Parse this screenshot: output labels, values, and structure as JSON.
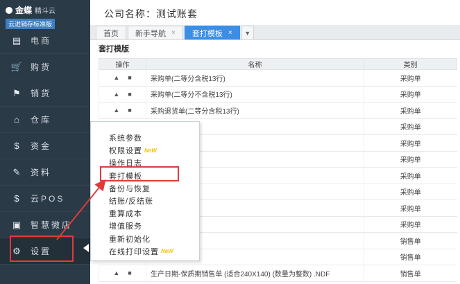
{
  "app": {
    "brand": "金蝶",
    "brand_sub": "精斗云",
    "tag": "云进销存标准版"
  },
  "sidebar": {
    "items": [
      {
        "label": "电商",
        "icon": "store-icon",
        "glyph": "▤"
      },
      {
        "label": "购货",
        "icon": "cart-icon",
        "glyph": "🛒"
      },
      {
        "label": "销货",
        "icon": "sales-icon",
        "glyph": "⚑"
      },
      {
        "label": "仓库",
        "icon": "warehouse-icon",
        "glyph": "⌂"
      },
      {
        "label": "资金",
        "icon": "money-icon",
        "glyph": "$"
      },
      {
        "label": "资料",
        "icon": "pen-icon",
        "glyph": "✎"
      },
      {
        "label": "云POS",
        "icon": "pos-icon",
        "glyph": "$"
      },
      {
        "label": "智慧微店",
        "icon": "shop-icon",
        "glyph": "▣"
      },
      {
        "label": "设置",
        "icon": "gear-icon",
        "glyph": "⚙"
      }
    ]
  },
  "header": {
    "title": "公司名称：测试账套"
  },
  "tabs": [
    {
      "label": "首页",
      "closable": false
    },
    {
      "label": "新手导航",
      "closable": true
    },
    {
      "label": "套打模板",
      "closable": true,
      "active": true
    }
  ],
  "section_title": "套打模版",
  "table": {
    "headers": [
      "操作",
      "名称",
      "类别"
    ],
    "ops_glyphs": [
      "▲",
      "■"
    ],
    "rows": [
      {
        "name": "采购单(二等分含税13行)",
        "category": "采购单"
      },
      {
        "name": "采购单(二等分不含税13行)",
        "category": "采购单"
      },
      {
        "name": "采购退货单(二等分含税13行)",
        "category": "采购单"
      },
      {
        "name": "分不含税13行)",
        "category": "采购单"
      },
      {
        "name": "",
        "category": "采购单"
      },
      {
        "name": "助属性)",
        "category": "采购单"
      },
      {
        "name": "助属性_无金额)",
        "category": "采购单"
      },
      {
        "name": "质期批次)",
        "category": "采购单"
      },
      {
        "name": "",
        "category": "采购单"
      },
      {
        "name": "",
        "category": "采购单"
      },
      {
        "name": "",
        "category": "销售单"
      },
      {
        "name": "",
        "category": "销售单"
      },
      {
        "name": "生产日期-保质期销售单 (适合240X140) (数量为整数) .NDF",
        "category": "销售单"
      }
    ]
  },
  "popup_menu": {
    "items": [
      {
        "label": "系统参数",
        "new": false
      },
      {
        "label": "权限设置",
        "new": true
      },
      {
        "label": "操作日志",
        "new": false
      },
      {
        "label": "套打模板",
        "new": false,
        "highlighted": true
      },
      {
        "label": "备份与恢复",
        "new": false
      },
      {
        "label": "结账/反结账",
        "new": false
      },
      {
        "label": "重算成本",
        "new": false
      },
      {
        "label": "增值服务",
        "new": false
      },
      {
        "label": "重新初始化",
        "new": false
      },
      {
        "label": "在线打印设置",
        "new": true
      }
    ],
    "new_badge": "NeW"
  },
  "colors": {
    "sidebar_bg": "#2b3a47",
    "accent": "#3a8ee6",
    "highlight_red": "#e03b3b",
    "new_badge": "#f5c400"
  }
}
